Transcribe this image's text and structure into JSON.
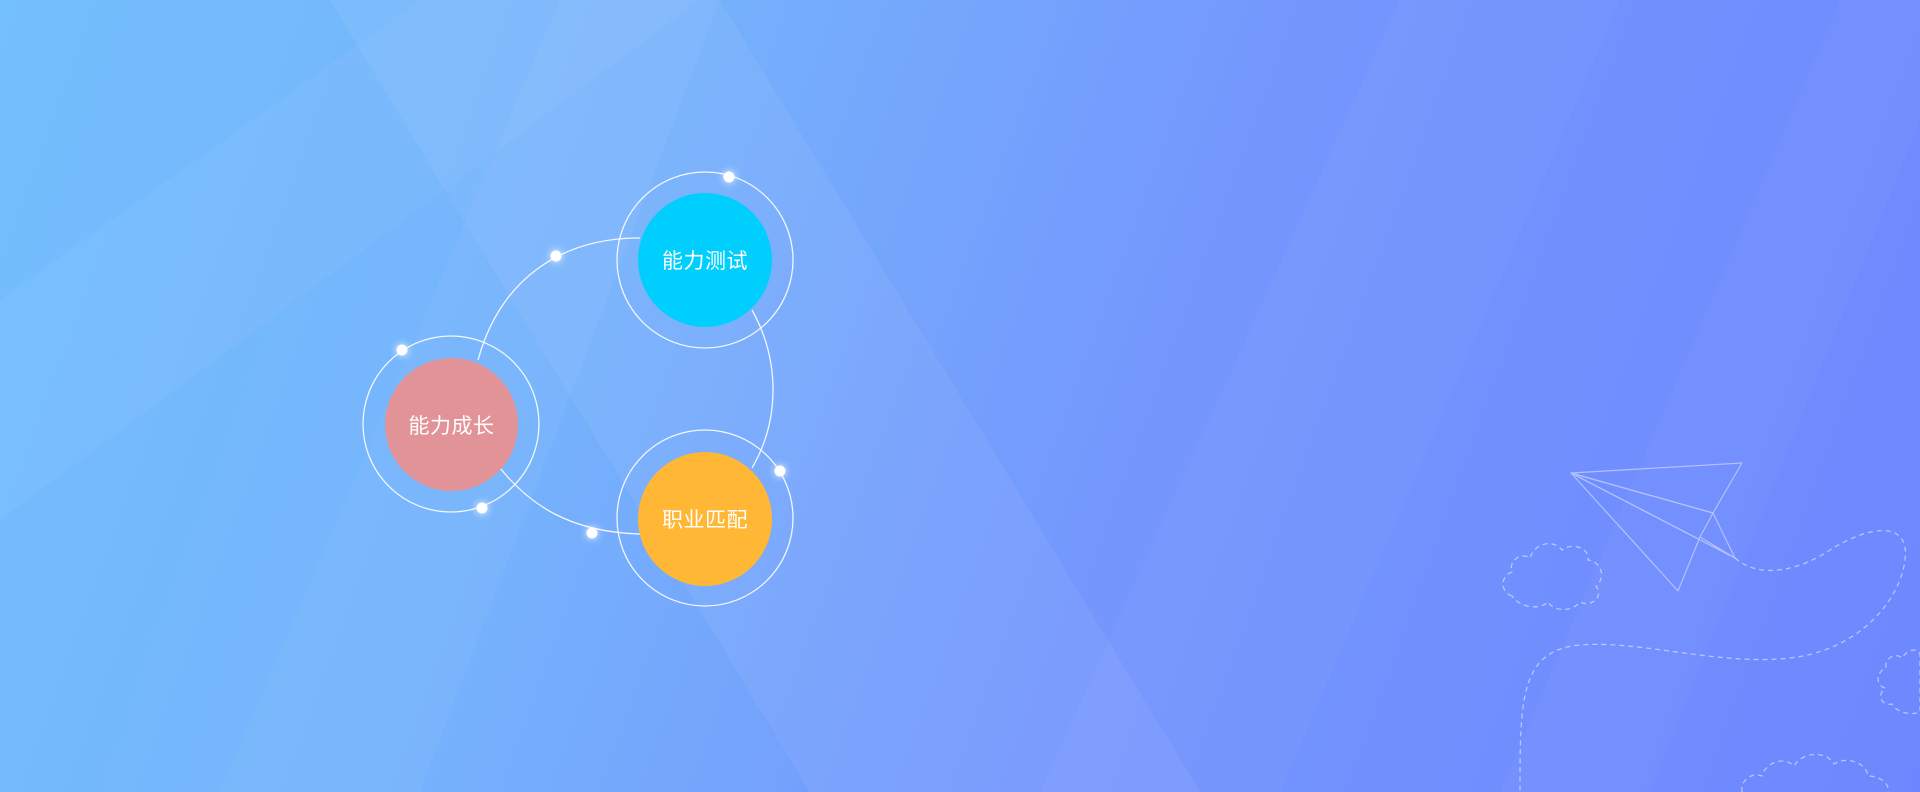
{
  "nodes": {
    "growth": {
      "label": "能力成长",
      "color": "#e29398"
    },
    "test": {
      "label": "能力测试",
      "color": "#00cffe"
    },
    "match": {
      "label": "职业匹配",
      "color": "#ffb735"
    }
  },
  "decorations": {
    "icons": [
      "paper-plane-icon",
      "cloud-icon",
      "dashed-flight-path"
    ]
  },
  "colors": {
    "background_start": "#74bffd",
    "background_end": "#6e87fe",
    "ring": "#ffffff"
  }
}
